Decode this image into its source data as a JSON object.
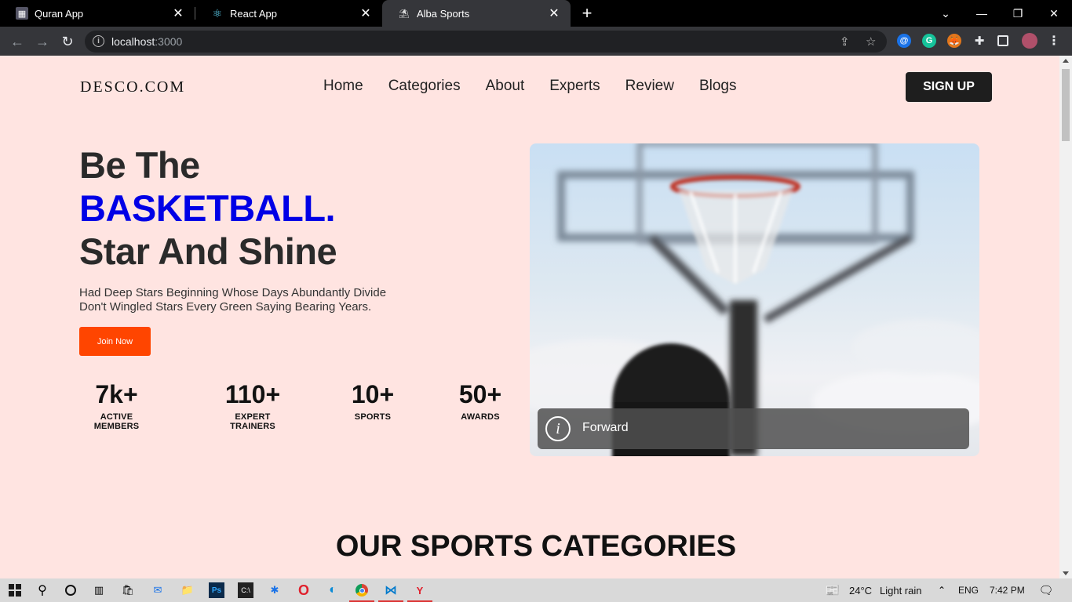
{
  "browser": {
    "tabs": [
      {
        "title": "Quran App",
        "active": false
      },
      {
        "title": "React App",
        "active": false
      },
      {
        "title": "Alba Sports",
        "active": true
      }
    ],
    "url_host": "localhost",
    "url_port": ":3000"
  },
  "site": {
    "brand": "DESCO.COM",
    "nav": [
      "Home",
      "Categories",
      "About",
      "Experts",
      "Review",
      "Blogs"
    ],
    "signup_label": "SIGN UP"
  },
  "hero": {
    "title_line1": "Be The",
    "title_accent": "BASKETBALL.",
    "title_line3": "Star And Shine",
    "description": "Had Deep Stars Beginning Whose Days Abundantly Divide Don't Wingled Stars Every Green Saying Bearing Years.",
    "cta_label": "Join Now",
    "stats": [
      {
        "value": "7k+",
        "label": "ACTIVE MEMBERS"
      },
      {
        "value": "110+",
        "label": "EXPERT TRAINERS"
      },
      {
        "value": "10+",
        "label": "SPORTS"
      },
      {
        "value": "50+",
        "label": "AWARDS"
      }
    ],
    "image_caption": "Forward"
  },
  "section_title": "OUR SPORTS CATEGORIES",
  "taskbar": {
    "weather": "24°C",
    "weather_desc": "Light rain",
    "language": "ENG",
    "time": "7:42 PM"
  },
  "colors": {
    "page_bg": "#ffe4e1",
    "accent_blue": "#0000e6",
    "cta_orange": "#ff4500",
    "dark_button": "#1e1e1e"
  }
}
